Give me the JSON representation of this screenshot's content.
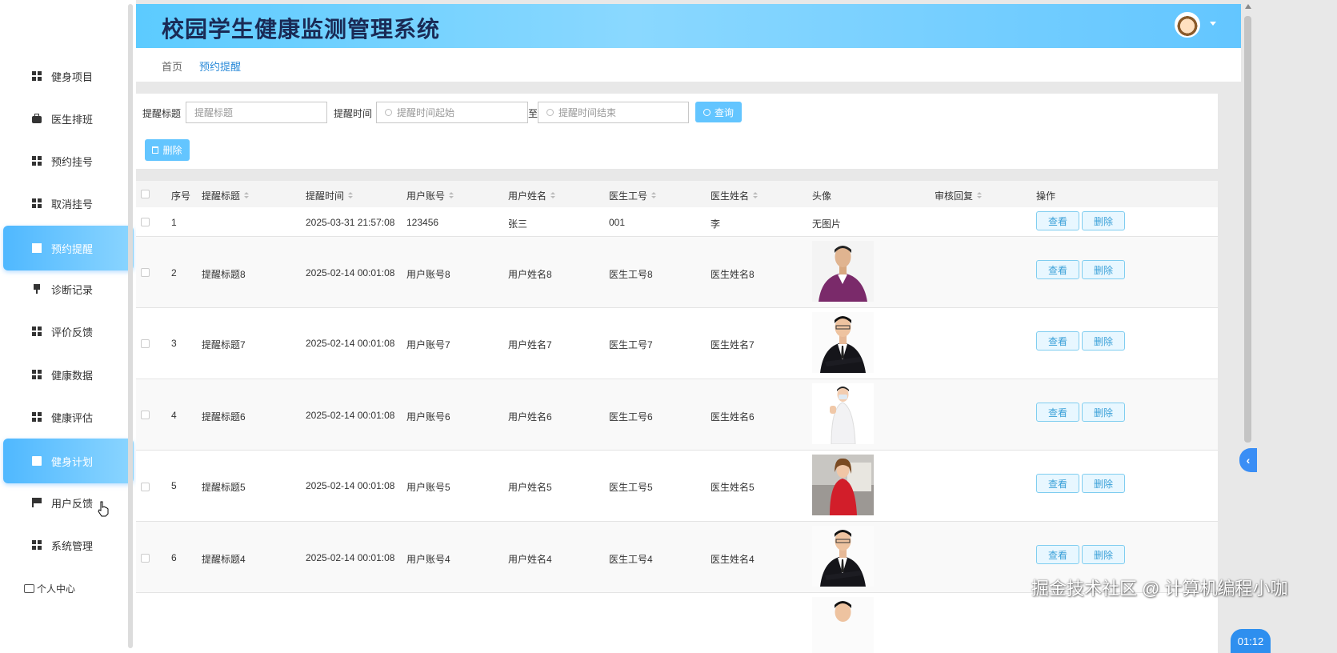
{
  "app": {
    "title": "校园学生健康监测管理系统"
  },
  "sidebar": {
    "items": [
      {
        "label": "健身项目",
        "icon": "grid-icon",
        "active": false
      },
      {
        "label": "医生排班",
        "icon": "briefcase-icon",
        "active": false
      },
      {
        "label": "预约挂号",
        "icon": "grid-icon",
        "active": false
      },
      {
        "label": "取消挂号",
        "icon": "grid-icon",
        "active": false
      },
      {
        "label": "预约提醒",
        "icon": "book-icon",
        "active": true
      },
      {
        "label": "诊断记录",
        "icon": "pin-icon",
        "active": false
      },
      {
        "label": "评价反馈",
        "icon": "grid-icon",
        "active": false
      },
      {
        "label": "健康数据",
        "icon": "grid-icon",
        "active": false
      },
      {
        "label": "健康评估",
        "icon": "grid-icon",
        "active": false
      },
      {
        "label": "健身计划",
        "icon": "clipboard-icon",
        "active": true
      },
      {
        "label": "用户反馈",
        "icon": "flag-icon",
        "active": false
      },
      {
        "label": "系统管理",
        "icon": "grid-icon",
        "active": false
      }
    ],
    "personal_center": "个人中心"
  },
  "breadcrumb": {
    "home": "首页",
    "current": "预约提醒"
  },
  "search": {
    "title_label": "提醒标题",
    "title_placeholder": "提醒标题",
    "time_label": "提醒时间",
    "time_start_placeholder": "提醒时间起始",
    "range_sep": "至",
    "time_end_placeholder": "提醒时间结束",
    "query_button": "查询",
    "delete_button": "删除"
  },
  "table": {
    "headers": [
      "序号",
      "提醒标题",
      "提醒时间",
      "用户账号",
      "用户姓名",
      "医生工号",
      "医生姓名",
      "头像",
      "审核回复",
      "操作"
    ],
    "view_label": "查看",
    "delete_label": "删除",
    "rows": [
      {
        "no": "1",
        "title": "",
        "time": "2025-03-31 21:57:08",
        "account": "123456",
        "username": "张三",
        "doctor_id": "001",
        "doctor_name": "李",
        "avatar": "无图片",
        "reply": ""
      },
      {
        "no": "2",
        "title": "提醒标题8",
        "time": "2025-02-14 00:01:08",
        "account": "用户账号8",
        "username": "用户姓名8",
        "doctor_id": "医生工号8",
        "doctor_name": "医生姓名8",
        "avatar": "photo",
        "reply": ""
      },
      {
        "no": "3",
        "title": "提醒标题7",
        "time": "2025-02-14 00:01:08",
        "account": "用户账号7",
        "username": "用户姓名7",
        "doctor_id": "医生工号7",
        "doctor_name": "医生姓名7",
        "avatar": "photo",
        "reply": ""
      },
      {
        "no": "4",
        "title": "提醒标题6",
        "time": "2025-02-14 00:01:08",
        "account": "用户账号6",
        "username": "用户姓名6",
        "doctor_id": "医生工号6",
        "doctor_name": "医生姓名6",
        "avatar": "photo",
        "reply": ""
      },
      {
        "no": "5",
        "title": "提醒标题5",
        "time": "2025-02-14 00:01:08",
        "account": "用户账号5",
        "username": "用户姓名5",
        "doctor_id": "医生工号5",
        "doctor_name": "医生姓名5",
        "avatar": "photo",
        "reply": ""
      },
      {
        "no": "6",
        "title": "提醒标题4",
        "time": "2025-02-14 00:01:08",
        "account": "用户账号4",
        "username": "用户姓名4",
        "doctor_id": "医生工号4",
        "doctor_name": "医生姓名4",
        "avatar": "photo",
        "reply": ""
      }
    ]
  },
  "overlay": {
    "watermark": "掘金技术社区 @ 计算机编程小咖",
    "timer": "01:12"
  },
  "colors": {
    "accent": "#63c5ff",
    "header_text": "#1a2a55",
    "link": "#2a8ad8"
  }
}
